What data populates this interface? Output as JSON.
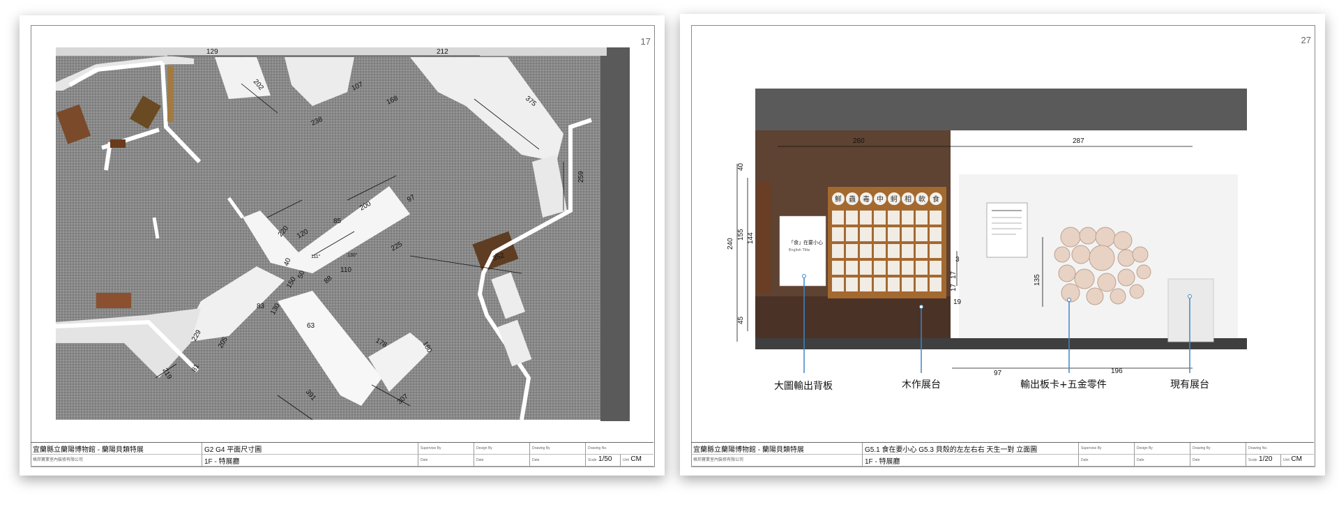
{
  "left_sheet": {
    "page_number": "17",
    "dims": {
      "d129": "129",
      "d212": "212",
      "d202": "202",
      "d238": "238",
      "d107": "107",
      "d168": "168",
      "d375": "375",
      "d259": "259",
      "d200": "200",
      "d97": "97",
      "d85": "85",
      "d220": "220",
      "d120": "120",
      "d225": "225",
      "d110": "110",
      "d40": "40",
      "d50": "50",
      "d150": "150",
      "d83": "83",
      "d88": "88",
      "d130": "130",
      "d352": "352",
      "d63": "63",
      "d178": "178",
      "d180": "180",
      "d229": "229",
      "d205": "205",
      "d219": "219",
      "d81": "81",
      "d391": "391",
      "d307": "307",
      "a111": "111°",
      "a130": "130°"
    },
    "titleblock": {
      "museum": "宜蘭縣立蘭陽博物館 - 蘭陽貝類特展",
      "company": "格邦寶業室內裝修有限公司",
      "drawing_title": "G2 G4 平面尺寸圖",
      "floor": "1F - 特展廳",
      "scale_label": "Scale",
      "scale": "1/50",
      "unit_label": "Unit",
      "unit": "CM",
      "supervise": "Supervise By",
      "design": "Design By",
      "drawing": "Drawing By",
      "drawing_no": "Drawing No.",
      "date1": "Date",
      "date2": "Date",
      "date3": "Date"
    }
  },
  "right_sheet": {
    "page_number": "27",
    "dims": {
      "w260": "260",
      "w287": "287",
      "h40": "40",
      "h240": "240",
      "h155": "155",
      "h144": "144",
      "h45": "45",
      "h3": "3",
      "h17a": "17",
      "h17b": "17",
      "h19": "19",
      "h135": "135",
      "w97": "97",
      "w196": "196"
    },
    "panel_title": "「食」在要小心",
    "panel_subtitle": "English Title",
    "tiles": [
      "鮮",
      "蟲",
      "毒",
      "中",
      "蚵",
      "相",
      "軟",
      "食"
    ],
    "callouts": {
      "backboard": "大圖輸出背板",
      "wood_stand": "木作展台",
      "output_card": "輸出板卡+五金零件",
      "existing_stand": "現有展台"
    },
    "titleblock": {
      "museum": "宜蘭縣立蘭陽博物館 - 蘭陽貝類特展",
      "company": "格邦寶業室內裝修有限公司",
      "drawing_title": "G5.1 食在要小心 G5.3 貝殼的左左右右 天生一對 立面圖",
      "floor": "1F - 特展廳",
      "scale_label": "Scale",
      "scale": "1/20",
      "unit_label": "Unit",
      "unit": "CM",
      "supervise": "Supervise By",
      "design": "Design By",
      "drawing": "Drawing By",
      "drawing_no": "Drawing No.",
      "date1": "Date",
      "date2": "Date",
      "date3": "Date"
    }
  }
}
